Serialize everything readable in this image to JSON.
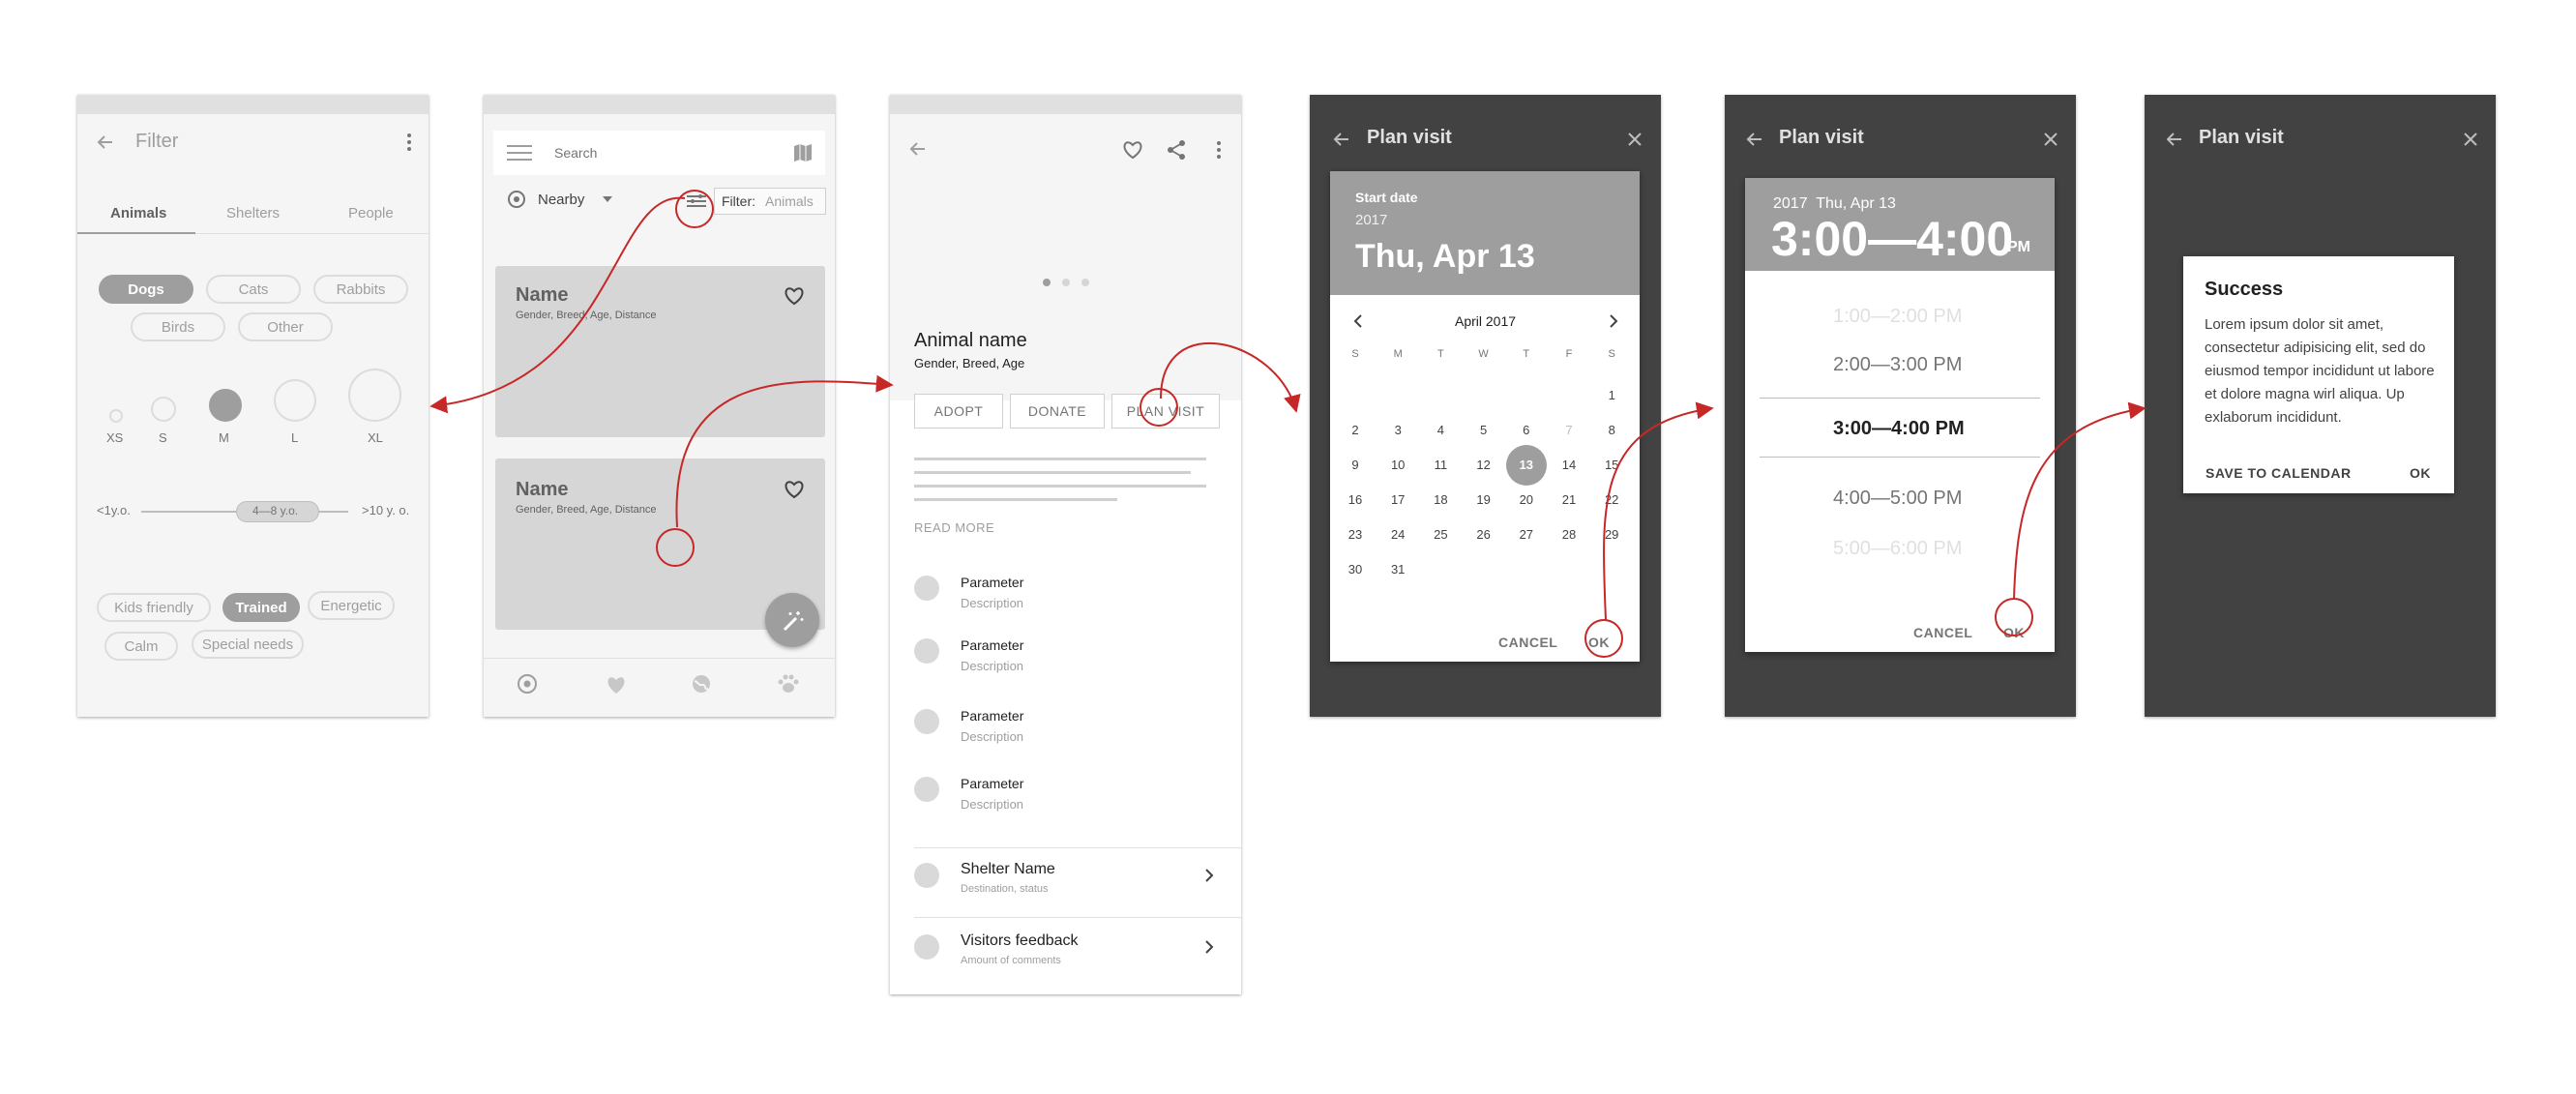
{
  "screen1": {
    "title": "Filter",
    "tabs": [
      "Animals",
      "Shelters",
      "People"
    ],
    "species": [
      "Dogs",
      "Cats",
      "Rabbits",
      "Birds",
      "Other"
    ],
    "sizes": [
      "XS",
      "S",
      "M",
      "L",
      "XL"
    ],
    "age_min": "<1y.o.",
    "age_range": "4—8 y.o.",
    "age_max": ">10 y. o.",
    "traits": [
      "Kids friendly",
      "Trained",
      "Energetic",
      "Calm",
      "Special needs"
    ]
  },
  "screen2": {
    "search_placeholder": "Search",
    "nearby": "Nearby",
    "filter_label": "Filter:",
    "filter_value": "Animals",
    "cards": [
      {
        "name": "Name",
        "details": "Gender, Breed, Age, Distance"
      },
      {
        "name": "Name",
        "details": "Gender, Breed, Age, Distance"
      }
    ]
  },
  "screen3": {
    "animal_name": "Animal name",
    "animal_details": "Gender, Breed, Age",
    "buttons": [
      "ADOPT",
      "DONATE",
      "PLAN VISIT"
    ],
    "read_more": "READ MORE",
    "params": [
      {
        "title": "Parameter",
        "desc": "Description"
      },
      {
        "title": "Parameter",
        "desc": "Description"
      },
      {
        "title": "Parameter",
        "desc": "Description"
      },
      {
        "title": "Parameter",
        "desc": "Description"
      }
    ],
    "shelter": {
      "title": "Shelter Name",
      "desc": "Destination, status"
    },
    "feedback": {
      "title": "Visitors feedback",
      "desc": "Amount of comments"
    }
  },
  "screen4": {
    "title": "Plan visit",
    "start_date_label": "Start date",
    "year": "2017",
    "date": "Thu, Apr 13",
    "month": "April 2017",
    "weekdays": [
      "S",
      "M",
      "T",
      "W",
      "T",
      "F",
      "S"
    ],
    "weeks": [
      [
        "",
        "",
        "",
        "",
        "",
        "",
        "1"
      ],
      [
        "2",
        "3",
        "4",
        "5",
        "6",
        "7",
        "8"
      ],
      [
        "9",
        "10",
        "11",
        "12",
        "13",
        "14",
        "15"
      ],
      [
        "16",
        "17",
        "18",
        "19",
        "20",
        "21",
        "22"
      ],
      [
        "23",
        "24",
        "25",
        "26",
        "27",
        "28",
        "29"
      ],
      [
        "30",
        "31",
        "",
        "",
        "",
        "",
        ""
      ]
    ],
    "selected_day": "13",
    "cancel": "CANCEL",
    "ok": "OK"
  },
  "screen5": {
    "title": "Plan visit",
    "header_date": "2017  Thu, Apr 13",
    "time": "3:00—4:00",
    "ampm": "PM",
    "slots": [
      "1:00—2:00 PM",
      "2:00—3:00 PM",
      "3:00—4:00 PM",
      "4:00—5:00 PM",
      "5:00—6:00 PM"
    ],
    "cancel": "CANCEL",
    "ok": "OK"
  },
  "screen6": {
    "title": "Plan visit",
    "dialog_title": "Success",
    "dialog_body": "Lorem ipsum dolor sit amet, consectetur adipisicing elit, sed do eiusmod tempor incididunt ut labore et dolore magna wirl aliqua. Up exlaborum incididunt.",
    "save": "SAVE TO CALENDAR",
    "ok": "OK"
  },
  "colors": {
    "accent_arrow": "#c62828",
    "chip_selected": "#9e9e9e",
    "dark_bg": "#424242",
    "card_bg": "#d6d6d6"
  }
}
